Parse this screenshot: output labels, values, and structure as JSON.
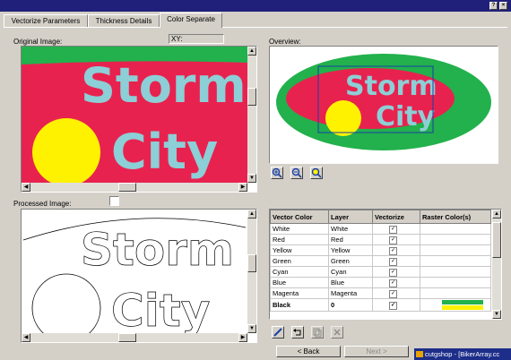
{
  "window": {
    "help_button": "?",
    "close_button": "×"
  },
  "tabs": [
    {
      "label": "Vectorize Parameters",
      "active": false
    },
    {
      "label": "Thickness Details",
      "active": false
    },
    {
      "label": "Color Separate",
      "active": true
    }
  ],
  "original_image": {
    "label": "Original Image:",
    "xy_label": "XY:",
    "text_line1": "Storm",
    "text_line2": "City"
  },
  "overview": {
    "label": "Overview:",
    "text_line1": "Storm",
    "text_line2": "City"
  },
  "processed_image": {
    "label": "Processed Image:",
    "text_line1": "Storm",
    "text_line2": "City"
  },
  "zoom_tools": [
    "zoom-in-icon",
    "zoom-out-icon",
    "zoom-fit-icon"
  ],
  "vector_table": {
    "headers": [
      "Vector Color",
      "Layer",
      "Vectorize",
      "Raster Color(s)"
    ],
    "rows": [
      {
        "color": "White",
        "layer": "White",
        "vectorize": true,
        "bold": false,
        "raster": []
      },
      {
        "color": "Red",
        "layer": "Red",
        "vectorize": true,
        "bold": false,
        "raster": []
      },
      {
        "color": "Yellow",
        "layer": "Yellow",
        "vectorize": true,
        "bold": false,
        "raster": []
      },
      {
        "color": "Green",
        "layer": "Green",
        "vectorize": true,
        "bold": false,
        "raster": []
      },
      {
        "color": "Cyan",
        "layer": "Cyan",
        "vectorize": true,
        "bold": false,
        "raster": []
      },
      {
        "color": "Blue",
        "layer": "Blue",
        "vectorize": true,
        "bold": false,
        "raster": []
      },
      {
        "color": "Magenta",
        "layer": "Magenta",
        "vectorize": true,
        "bold": false,
        "raster": []
      },
      {
        "color": "Black",
        "layer": "0",
        "vectorize": true,
        "bold": true,
        "raster": [
          "#22b14c",
          "#fff200"
        ]
      }
    ]
  },
  "table_tools": [
    "pencil-icon",
    "undo-icon",
    "copy-icon",
    "delete-icon"
  ],
  "buttons": {
    "back": "< Back",
    "next": "Next >"
  },
  "taskbar": {
    "item": "cutgshop - [BikerArray.cc"
  },
  "colors": {
    "green": "#22b14c",
    "red": "#e8224f",
    "cyan": "#8ccfd6",
    "yellow": "#fff200",
    "title": "#20207a"
  }
}
